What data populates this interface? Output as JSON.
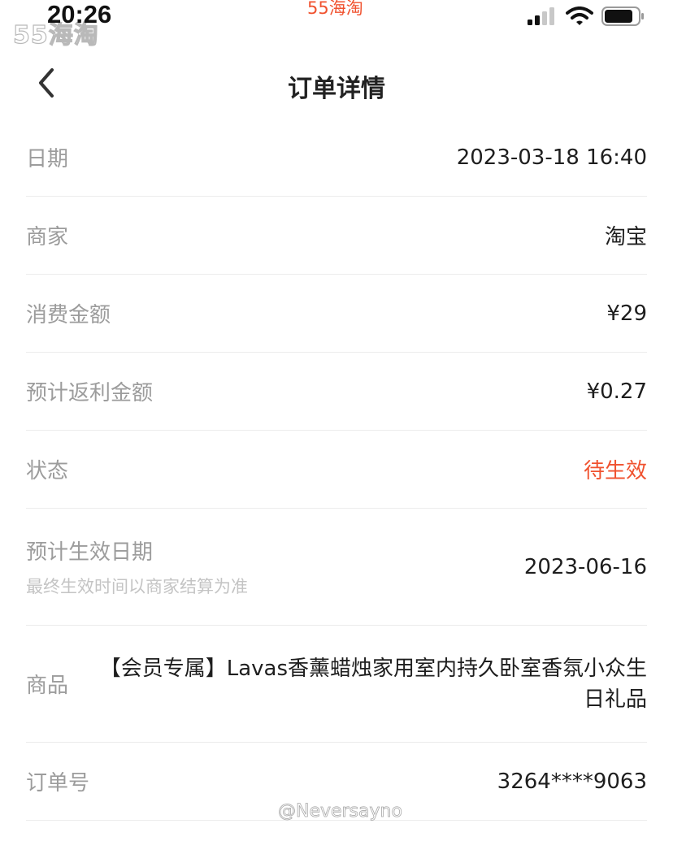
{
  "status_bar": {
    "watermark_logo": "55海淘",
    "time": "20:26",
    "brand": "55海淘"
  },
  "nav": {
    "title": "订单详情"
  },
  "rows": {
    "date": {
      "label": "日期",
      "value": "2023-03-18 16:40"
    },
    "merchant": {
      "label": "商家",
      "value": "淘宝"
    },
    "amount": {
      "label": "消费金额",
      "value": "¥29"
    },
    "rebate": {
      "label": "预计返利金额",
      "value": "¥0.27"
    },
    "status": {
      "label": "状态",
      "value": "待生效"
    },
    "effective_date": {
      "label": "预计生效日期",
      "sublabel": "最终生效时间以商家结算为准",
      "value": "2023-06-16"
    },
    "product": {
      "label": "商品",
      "value": "【会员专属】Lavas香薰蜡烛家用室内持久卧室香氛小众生日礼品"
    },
    "order_no": {
      "label": "订单号",
      "value": "3264****9063"
    }
  },
  "footer": {
    "watermark": "@Neversayno"
  },
  "colors": {
    "accent": "#f0522f",
    "label": "#9c9c9c",
    "value": "#1e1e1e",
    "divider": "#ececec"
  }
}
